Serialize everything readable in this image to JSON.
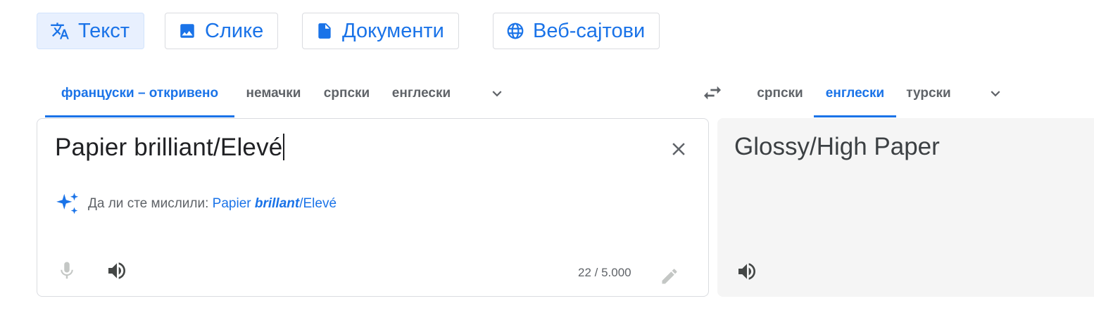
{
  "modes": [
    {
      "label": "Текст",
      "icon": "translate-icon",
      "active": true
    },
    {
      "label": "Слике",
      "icon": "image-icon",
      "active": false
    },
    {
      "label": "Документи",
      "icon": "document-icon",
      "active": false
    },
    {
      "label": "Веб-сајтови",
      "icon": "globe-icon",
      "active": false
    }
  ],
  "source_langs": [
    {
      "label": "француски – откривено",
      "active": true
    },
    {
      "label": "немачки",
      "active": false
    },
    {
      "label": "српски",
      "active": false
    },
    {
      "label": "енглески",
      "active": false
    }
  ],
  "target_langs": [
    {
      "label": "српски",
      "active": false
    },
    {
      "label": "енглески",
      "active": true
    },
    {
      "label": "турски",
      "active": false
    }
  ],
  "source": {
    "text": "Papier brilliant/Elevé",
    "suggestion_prefix": "Да ли сте мислили:",
    "suggestion_part1": "Papier",
    "suggestion_bold": "brillant",
    "suggestion_part2": "/Elevé",
    "char_count": "22 / 5.000"
  },
  "target": {
    "text": "Glossy/High Paper"
  },
  "colors": {
    "accent": "#1a73e8",
    "active_mode_bg": "#e8f0fe",
    "target_bg": "#f5f5f5",
    "muted": "#5f6368"
  }
}
